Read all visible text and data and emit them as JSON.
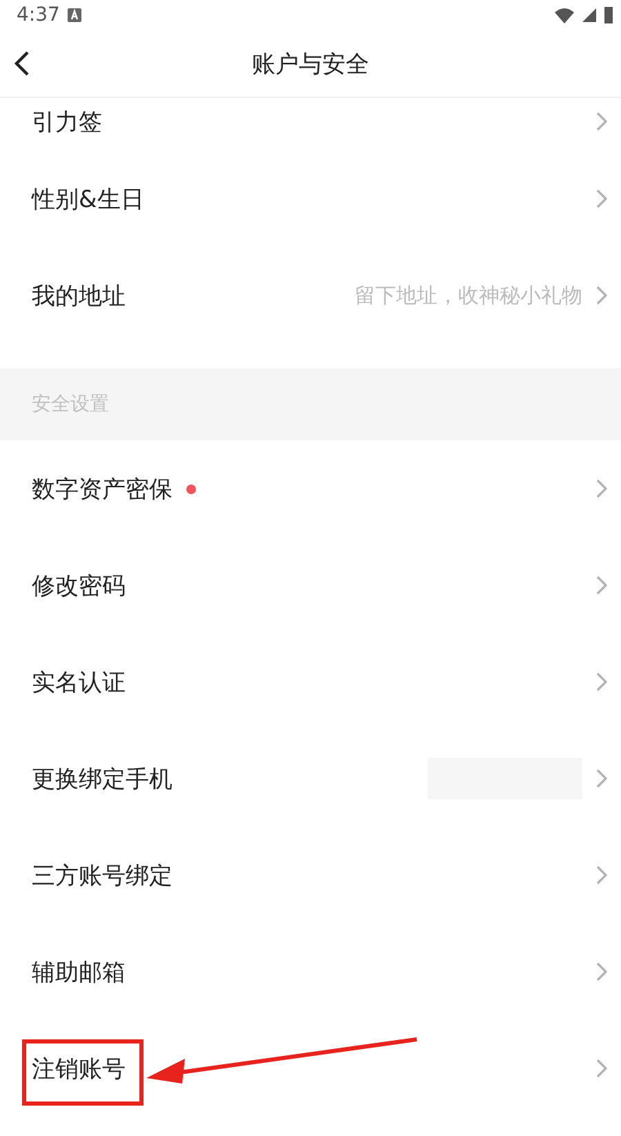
{
  "status_bar": {
    "time": "4:37"
  },
  "header": {
    "title": "账户与安全"
  },
  "groups": [
    {
      "rows": [
        {
          "label": "引力签",
          "partial": true
        },
        {
          "label": "性别&生日"
        },
        {
          "label": "我的地址",
          "hint": "留下地址，收神秘小礼物"
        }
      ]
    },
    {
      "title": "安全设置",
      "rows": [
        {
          "label": "数字资产密保",
          "badge": true
        },
        {
          "label": "修改密码"
        },
        {
          "label": "实名认证"
        },
        {
          "label": "更换绑定手机",
          "redacted": true
        },
        {
          "label": "三方账号绑定"
        },
        {
          "label": "辅助邮箱"
        },
        {
          "label": "注销账号",
          "highlighted": true
        }
      ]
    }
  ]
}
